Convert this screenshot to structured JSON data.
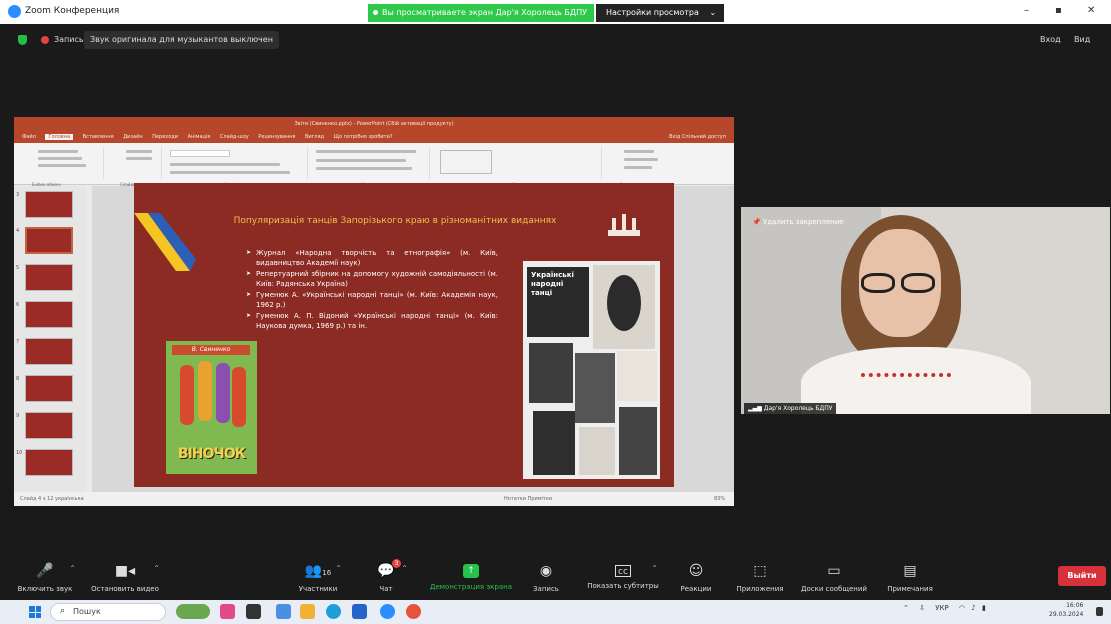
{
  "titlebar": {
    "app_name": "Zoom Конференция",
    "banner": "Вы просматриваете экран Дар'я Хоролець БДПУ",
    "view_options": "Настройки просмотра",
    "minimize": "–",
    "maximize": "▪",
    "close": "✕"
  },
  "meeting": {
    "record_label": "Запись",
    "sound_message": "Звук оригинала для музыкантов выключен",
    "signin": "Вход",
    "video": "Вид"
  },
  "ppt": {
    "title": "Звіти (Свиненко.pptx) - PowerPoint (Сбій активації продукту)",
    "tabs": [
      "Файл",
      "Головна",
      "Вставлення",
      "Дизайн",
      "Переходи",
      "Анімація",
      "Слайд-шоу",
      "Рецензування",
      "Вигляд",
      "Що потрібно зробити?"
    ],
    "share": "Вхід  Спільний доступ",
    "ribbon_groups": [
      "Буфер обміну",
      "Слайди",
      "Шрифт",
      "Абзац",
      "Малювання",
      "Редагування"
    ],
    "status": "Слайд 4 з 12   українська",
    "status_right": "Нотатки   Примітки",
    "zoom": "83%",
    "slide_numbers": [
      "3",
      "4",
      "5",
      "6",
      "7",
      "8",
      "9",
      "10"
    ]
  },
  "slide": {
    "title": "Популяризація танців Запорізького краю в різноманітних виданнях",
    "bullets": [
      "Журнал «Народна творчість та етнографія» (м. Київ, видавництво Академії наук)",
      "Репертуарний збірник на допомогу художній самодіяльності (м. Київ: Радянська Україна)",
      "Гуменюк А. «Українські народні танці» (м. Київ: Академія наук, 1962 р.)",
      "Гуменюк А. П. Відоний «Українські народні танці» (м. Київ: Наукова думка, 1969 р.) та ін."
    ],
    "book_author": "В. Свиненко",
    "book_title": "ВІНОЧОК",
    "collage_title": "Українські народні танці"
  },
  "camera": {
    "unpin": "Удалить закрепление",
    "name": "Дар'я Хоролець БДПУ"
  },
  "toolbar": {
    "items": [
      {
        "label": "Включить звук",
        "icon": "mic-muted-icon"
      },
      {
        "label": "Остановить видео",
        "icon": "video-icon"
      },
      {
        "label": "Участники",
        "icon": "participants-icon",
        "count": "16"
      },
      {
        "label": "Чат",
        "icon": "chat-icon",
        "badge": "3"
      },
      {
        "label": "Демонстрация экрана",
        "icon": "share-screen-icon"
      },
      {
        "label": "Запись",
        "icon": "record-icon"
      },
      {
        "label": "Показать субтитры",
        "icon": "captions-icon"
      },
      {
        "label": "Реакции",
        "icon": "reactions-icon"
      },
      {
        "label": "Приложения",
        "icon": "apps-icon"
      },
      {
        "label": "Доски сообщений",
        "icon": "whiteboard-icon"
      },
      {
        "label": "Примечания",
        "icon": "notes-icon"
      }
    ],
    "leave": "Выйти"
  },
  "taskbar": {
    "search": "Пошук",
    "lang": "УКР",
    "time": "16:06",
    "date": "29.03.2024"
  },
  "colors": {
    "slide_bg": "#8c2a24",
    "ppt_accent": "#b7472a",
    "share_green": "#26c34b",
    "leave_red": "#d7323b"
  }
}
